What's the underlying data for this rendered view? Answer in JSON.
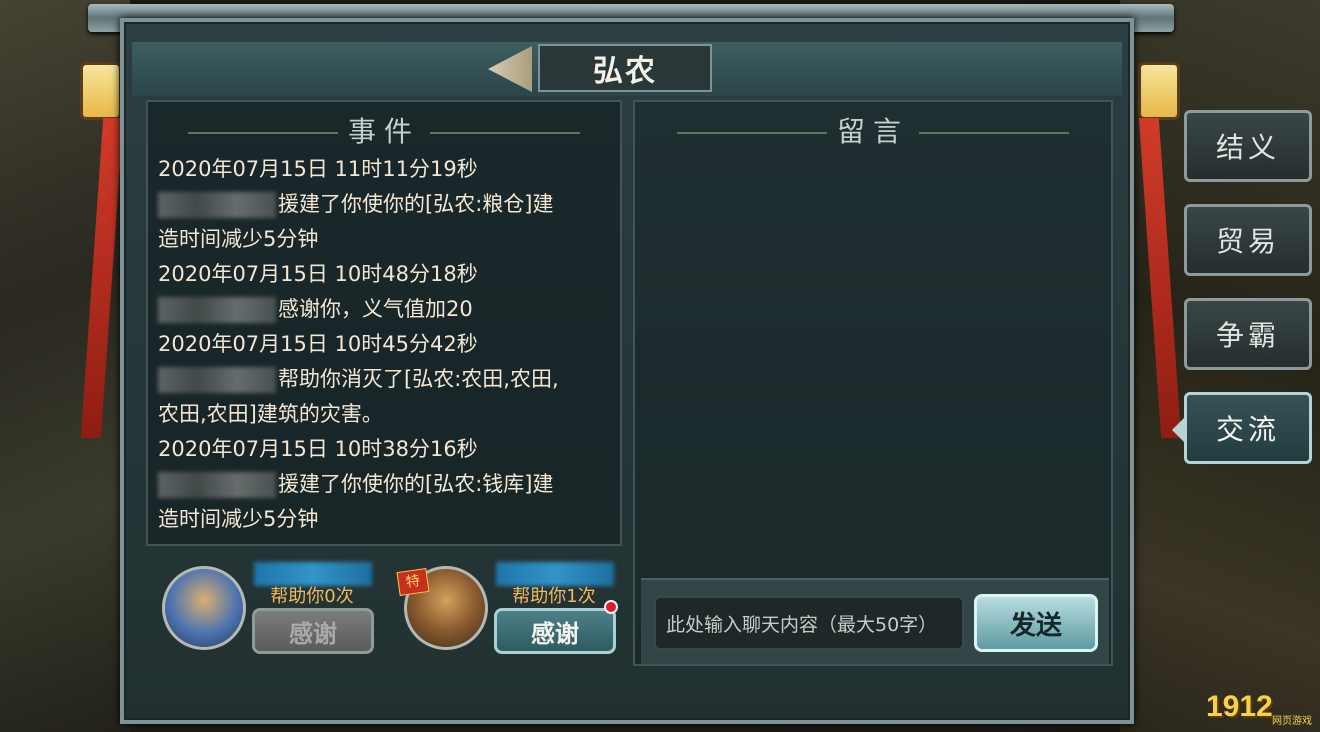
{
  "title": "弘农",
  "events_section": {
    "title": "事件",
    "entries": [
      {
        "time": "2020年07月15日 11时11分19秒",
        "text": "援建了你使你的[弘农:粮仓]建",
        "text2": "造时间减少5分钟"
      },
      {
        "time": "2020年07月15日 10时48分18秒",
        "text": "感谢你，义气值加20"
      },
      {
        "time": "2020年07月15日 10时45分42秒",
        "text": "帮助你消灭了[弘农:农田,农田,",
        "text2": "农田,农田]建筑的灾害。"
      },
      {
        "time": "2020年07月15日 10时38分16秒",
        "text": "援建了你使你的[弘农:钱库]建",
        "text2": "造时间减少5分钟"
      }
    ]
  },
  "message_section": {
    "title": "留言",
    "input_placeholder": "此处输入聊天内容（最大50字）",
    "send_label": "发送"
  },
  "helpers": [
    {
      "help_text": "帮助你0次",
      "thank_label": "感谢",
      "enabled": false
    },
    {
      "help_text": "帮助你1次",
      "thank_label": "感谢",
      "enabled": true,
      "badge": "特"
    }
  ],
  "side_tabs": [
    {
      "label": "结义",
      "active": false
    },
    {
      "label": "贸易",
      "active": false
    },
    {
      "label": "争霸",
      "active": false
    },
    {
      "label": "交流",
      "active": true
    }
  ],
  "watermark": {
    "number": "1912",
    "sub": "网页游戏"
  },
  "colors": {
    "accent_text": "#f2b95f",
    "event_text": "#f3e7d4",
    "notify_dot": "#e2182d"
  }
}
